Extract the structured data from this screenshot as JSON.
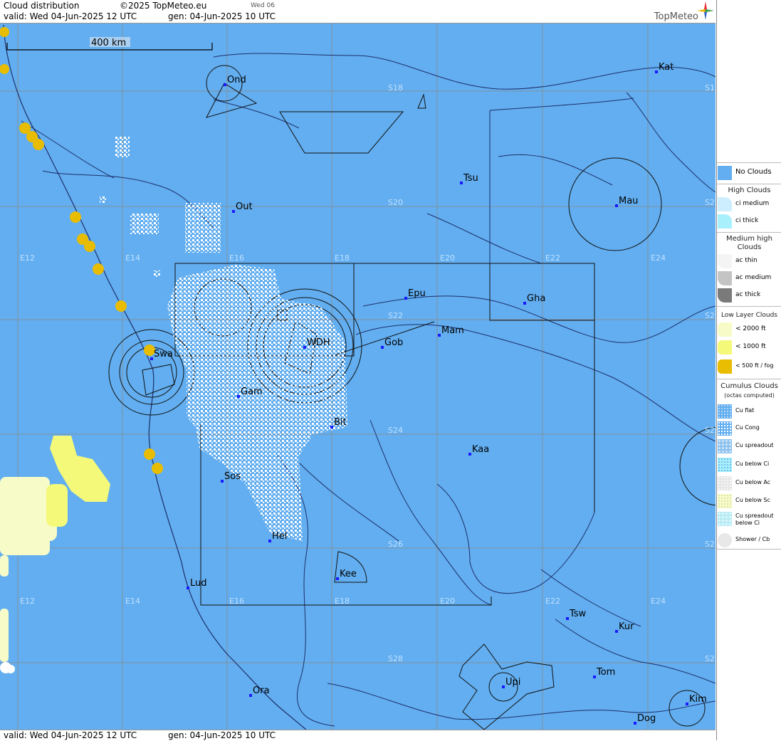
{
  "header": {
    "title": "Cloud distribution",
    "copyright": "©2025 TopMeteo.eu",
    "day_tab": "Wed 06",
    "valid": "valid:  Wed  04-Jun-2025  12 UTC",
    "gen": "gen: 04-Jun-2025 10 UTC",
    "logo": "TopMeteo"
  },
  "footer": {
    "valid": "valid:  Wed  04-Jun-2025  12 UTC",
    "gen": "gen: 04-Jun-2025 10 UTC"
  },
  "map": {
    "scale_label": "400 km",
    "lon_labels": [
      "E12",
      "E14",
      "E16",
      "E18",
      "E20",
      "E22",
      "E24"
    ],
    "lat_labels": [
      "S18",
      "S20",
      "S22",
      "S24",
      "S26",
      "S28"
    ],
    "edge_labels": [
      "S1",
      "S2",
      "S2",
      "S2",
      "S2",
      "S2"
    ],
    "places": [
      "Ond",
      "Kat",
      "Tsu",
      "Mau",
      "Out",
      "Epu",
      "Gha",
      "Mam",
      "Gob",
      "WDH",
      "Swa",
      "Gam",
      "Bit",
      "Kaa",
      "Sos",
      "Hel",
      "Kee",
      "Lud",
      "Tsw",
      "Kur",
      "Tom",
      "Upi",
      "Ora",
      "Kim",
      "Dog"
    ]
  },
  "legend": {
    "no_clouds": "No Clouds",
    "high_title": "High Clouds",
    "ci_medium": "ci medium",
    "ci_thick": "ci thick",
    "medium_title": "Medium high Clouds",
    "ac_thin": "ac thin",
    "ac_medium": "ac medium",
    "ac_thick": "ac thick",
    "low_title": "Low Layer Clouds",
    "lt2000": "< 2000 ft",
    "lt1000": "< 1000 ft",
    "lt500": "< 500 ft / fog",
    "cu_title": "Cumulus Clouds",
    "cu_sub": "(octas computed)",
    "cu_flat": "Cu flat",
    "cu_cong": "Cu Cong",
    "cu_spreadout": "Cu spreadout",
    "cu_below_ci": "Cu below Ci",
    "cu_below_ac": "Cu below Ac",
    "cu_below_sc": "Cu below Sc",
    "cu_spreadout_below_ci": "Cu spreadout below Ci",
    "shower": "Shower / Cb"
  },
  "colors": {
    "no_clouds": "#62aef0",
    "fog": "#e8bc00",
    "lt1000": "#f4f97a",
    "lt2000": "#f6fbc8"
  }
}
